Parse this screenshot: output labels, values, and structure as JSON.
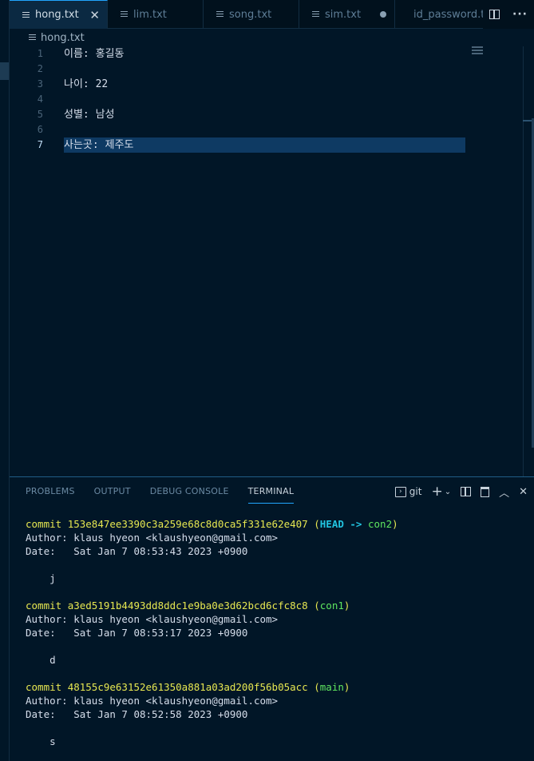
{
  "tabs": [
    {
      "label": "hong.txt",
      "active": true,
      "state": "close"
    },
    {
      "label": "lim.txt",
      "active": false,
      "state": "none"
    },
    {
      "label": "song.txt",
      "active": false,
      "state": "none"
    },
    {
      "label": "sim.txt",
      "active": false,
      "state": "dirty"
    },
    {
      "label": "id_password.txt",
      "active": false,
      "state": "none"
    }
  ],
  "breadcrumb": {
    "file": "hong.txt"
  },
  "editor": {
    "current_line": 7,
    "lines": [
      {
        "no": "1",
        "text": "이름: 홍길동"
      },
      {
        "no": "2",
        "text": ""
      },
      {
        "no": "3",
        "text": "나이: 22"
      },
      {
        "no": "4",
        "text": ""
      },
      {
        "no": "5",
        "text": "성별: 남성"
      },
      {
        "no": "6",
        "text": ""
      },
      {
        "no": "7",
        "text": "사는곳: 제주도"
      }
    ]
  },
  "panel": {
    "tabs": [
      "PROBLEMS",
      "OUTPUT",
      "DEBUG CONSOLE",
      "TERMINAL"
    ],
    "active_tab": "TERMINAL",
    "terminal_name": "git"
  },
  "terminal": {
    "commits": [
      {
        "commit_prefix": "commit ",
        "hash": "153e847ee3390c3a259e68c8d0ca5f331e62e407",
        "head": "HEAD -> ",
        "branch": "con2",
        "author": "Author: klaus hyeon <klaushyeon@gmail.com>",
        "date": "Date:   Sat Jan 7 08:53:43 2023 +0900",
        "message": "    j"
      },
      {
        "commit_prefix": "commit ",
        "hash": "a3ed5191b4493dd8ddc1e9ba0e3d62bcd6cfc8c8",
        "head": "",
        "branch": "con1",
        "author": "Author: klaus hyeon <klaushyeon@gmail.com>",
        "date": "Date:   Sat Jan 7 08:53:17 2023 +0900",
        "message": "    d"
      },
      {
        "commit_prefix": "commit ",
        "hash": "48155c9e63152e61350a881a03ad200f56b05acc",
        "head": "",
        "branch": "main",
        "author": "Author: klaus hyeon <klaushyeon@gmail.com>",
        "date": "Date:   Sat Jan 7 08:52:58 2023 +0900",
        "message": "    s"
      }
    ]
  },
  "colors": {
    "background": "#011627",
    "accent": "#21a6ff",
    "commit": "#e7e751",
    "head": "#22c4e0",
    "branch": "#5fe65f"
  },
  "icons": [
    "file-icon",
    "close-icon",
    "dirty-dot-icon",
    "split-editor-icon",
    "more-actions-icon",
    "terminal-icon",
    "add-icon",
    "chevron-down-icon",
    "split-terminal-icon",
    "trash-icon",
    "chevron-up-icon",
    "close-panel-icon"
  ]
}
